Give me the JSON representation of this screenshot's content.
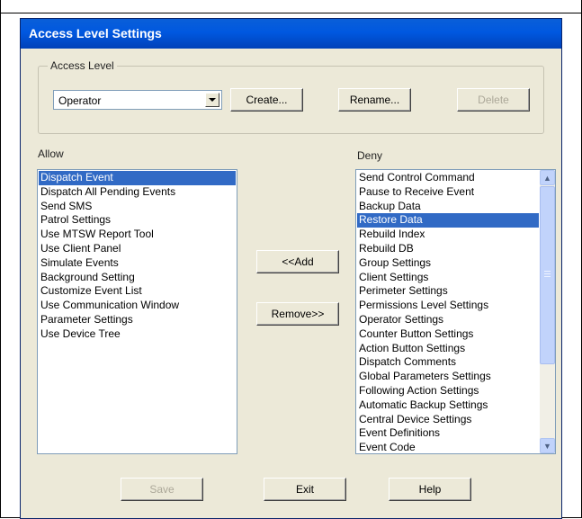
{
  "dialog": {
    "title": "Access Level Settings"
  },
  "access_level": {
    "group_label": "Access Level",
    "selected": "Operator",
    "buttons": {
      "create": "Create...",
      "rename": "Rename...",
      "delete": "Delete"
    }
  },
  "allow": {
    "label": "Allow",
    "items": [
      "Dispatch Event",
      "Dispatch All Pending Events",
      "Send SMS",
      "Patrol Settings",
      "Use MTSW Report Tool",
      "Use Client Panel",
      "Simulate Events",
      "Background Setting",
      "Customize Event List",
      "Use Communication Window",
      "Parameter Settings",
      "Use Device Tree"
    ],
    "selected_index": 0
  },
  "deny": {
    "label": "Deny",
    "items": [
      "Send Control Command",
      "Pause to Receive Event",
      "Backup Data",
      "Restore Data",
      "Rebuild Index",
      "Rebuild DB",
      "Group Settings",
      "Client Settings",
      "Perimeter Settings",
      "Permissions Level Settings",
      "Operator Settings",
      "Counter Button Settings",
      "Action Button Settings",
      "Dispatch Comments",
      "Global Parameters Settings",
      "Following Action Settings",
      "Automatic Backup Settings",
      "Central Device Settings",
      "Event Definitions",
      "Event Code"
    ],
    "selected_index": 3
  },
  "transfer": {
    "add": "<<Add",
    "remove": "Remove>>"
  },
  "footer": {
    "save": "Save",
    "exit": "Exit",
    "help": "Help"
  },
  "icons": {
    "combo_arrow": "chevron-down-icon",
    "scroll_up": "chevron-up-icon",
    "scroll_down": "chevron-down-icon",
    "thumb_grip": "grip-icon"
  }
}
